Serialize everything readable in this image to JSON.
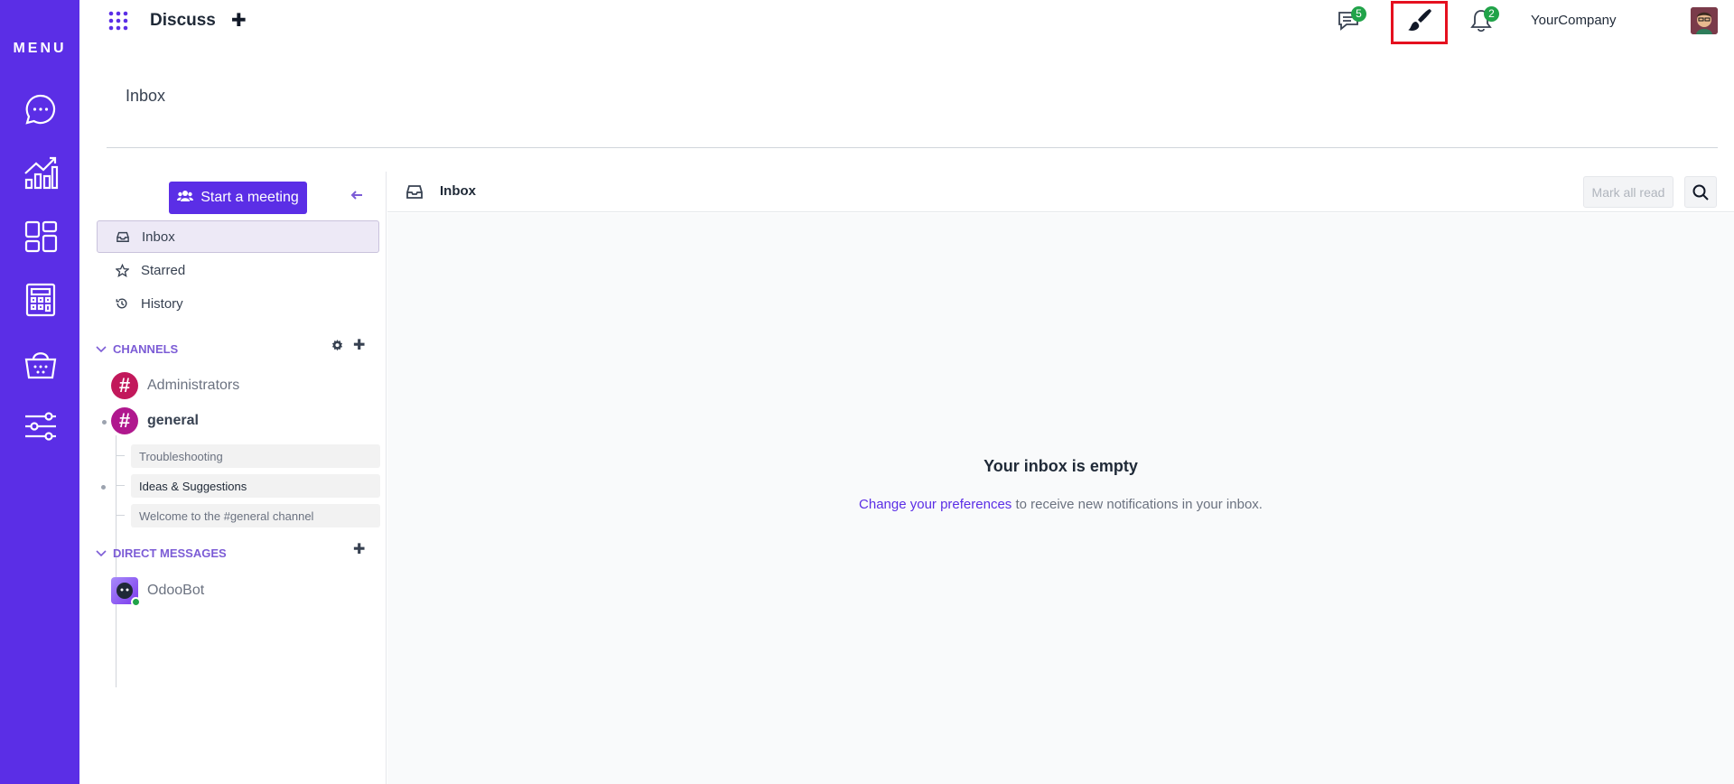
{
  "rail": {
    "menu_label": "MENU",
    "items": [
      {
        "icon": "chat-icon",
        "label": "Discuss"
      },
      {
        "icon": "chart-icon",
        "label": "Reporting"
      },
      {
        "icon": "apps-grid-icon",
        "label": "Apps"
      },
      {
        "icon": "calculator-icon",
        "label": "Accounting"
      },
      {
        "icon": "basket-icon",
        "label": "Sales"
      },
      {
        "icon": "sliders-icon",
        "label": "Settings"
      }
    ]
  },
  "topbar": {
    "app_title": "Discuss",
    "new_label": "✚",
    "messages_badge": "5",
    "notifications_badge": "2",
    "company": "YourCompany"
  },
  "breadcrumb": "Inbox",
  "sidebar": {
    "meeting_label": "Start a meeting",
    "nav": [
      {
        "label": "Inbox",
        "icon": "inbox-icon"
      },
      {
        "label": "Starred",
        "icon": "star-icon"
      },
      {
        "label": "History",
        "icon": "history-icon"
      }
    ],
    "channels_title": "CHANNELS",
    "channels": [
      {
        "name": "Administrators",
        "color": "#c2185b"
      },
      {
        "name": "general",
        "color": "#b0188e"
      }
    ],
    "threads": [
      "Troubleshooting",
      "Ideas & Suggestions",
      "Welcome to the #general channel"
    ],
    "dm_title": "DIRECT MESSAGES",
    "dms": [
      {
        "name": "OdooBot"
      }
    ]
  },
  "main": {
    "title": "Inbox",
    "mark_all_read": "Mark all read",
    "empty_title": "Your inbox is empty",
    "empty_link": "Change your preferences",
    "empty_rest": " to receive new notifications in your inbox."
  },
  "colors": {
    "primary": "#5b2ee6",
    "badge": "#21a349",
    "highlight_box": "#e5101f"
  }
}
